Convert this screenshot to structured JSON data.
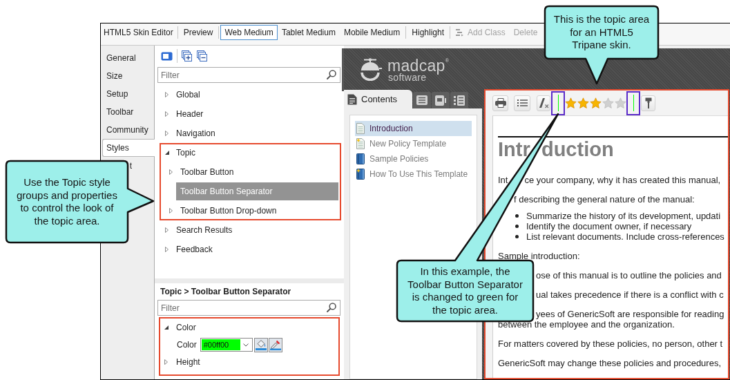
{
  "toolbar": {
    "title": "HTML5 Skin Editor",
    "groups": [
      [
        {
          "label": "Preview",
          "kind": "plain",
          "selected": false,
          "disabled": false
        }
      ],
      [
        {
          "label": "Web Medium",
          "kind": "plain",
          "selected": true,
          "disabled": false
        },
        {
          "label": "Tablet Medium",
          "kind": "plain",
          "selected": false,
          "disabled": false
        },
        {
          "label": "Mobile Medium",
          "kind": "plain",
          "selected": false,
          "disabled": false
        }
      ],
      [
        {
          "label": "Highlight",
          "kind": "plain",
          "selected": false,
          "disabled": false
        }
      ],
      [
        {
          "label": "Add Class",
          "kind": "with-icon",
          "selected": false,
          "disabled": true
        },
        {
          "label": "Delete",
          "kind": "plain",
          "selected": false,
          "disabled": true
        }
      ]
    ]
  },
  "side_tabs": [
    {
      "label": "General",
      "selected": false,
      "covered": false
    },
    {
      "label": "Size",
      "selected": false,
      "covered": false
    },
    {
      "label": "Setup",
      "selected": false,
      "covered": false
    },
    {
      "label": "Toolbar",
      "selected": false,
      "covered": false
    },
    {
      "label": "Community",
      "selected": false,
      "covered": false
    },
    {
      "label": "Styles",
      "selected": true,
      "covered": false
    },
    {
      "label": "t",
      "selected": false,
      "covered": true
    }
  ],
  "styles": {
    "filter": {
      "placeholder": "Filter"
    },
    "tree": [
      {
        "label": "Global",
        "kind": "group",
        "expanded": false,
        "selected": false,
        "highlighted": false
      },
      {
        "label": "Header",
        "kind": "group",
        "expanded": false,
        "selected": false,
        "highlighted": false
      },
      {
        "label": "Navigation",
        "kind": "group",
        "expanded": false,
        "selected": false,
        "highlighted": false
      },
      {
        "label": "Topic",
        "kind": "group",
        "expanded": true,
        "selected": false,
        "highlighted": true,
        "children": [
          {
            "label": "Toolbar Button",
            "kind": "group",
            "expanded": false,
            "selected": false,
            "highlighted": false
          },
          {
            "label": "Toolbar Button Separator",
            "kind": "leaf",
            "selected": true,
            "highlighted": false
          },
          {
            "label": "Toolbar Button Drop-down",
            "kind": "group",
            "expanded": false,
            "selected": false,
            "highlighted": false
          }
        ]
      },
      {
        "label": "Search Results",
        "kind": "group",
        "expanded": false,
        "selected": false,
        "highlighted": false
      },
      {
        "label": "Feedback",
        "kind": "group",
        "expanded": false,
        "selected": false,
        "highlighted": false
      }
    ],
    "path": "Topic > Toolbar Button Separator",
    "property_filter": {
      "placeholder": "Filter"
    },
    "properties": {
      "highlighted": true,
      "groups": [
        {
          "label": "Color",
          "expanded": true,
          "fields": [
            {
              "label": "Color",
              "value": "#00ff00"
            }
          ]
        },
        {
          "label": "Height",
          "expanded": false
        }
      ]
    }
  },
  "preview": {
    "logo": {
      "name": "madcap",
      "mark": "®",
      "tagline": "software"
    },
    "tabs": [
      {
        "label": "Contents",
        "selected": true
      },
      {
        "selected": false
      },
      {
        "selected": false
      },
      {
        "selected": false
      }
    ],
    "toc": [
      {
        "label": "Introduction",
        "kind": "page",
        "new": false,
        "selected": true
      },
      {
        "label": "New Policy Template",
        "kind": "page",
        "new": true,
        "selected": false
      },
      {
        "label": "Sample Policies",
        "kind": "book",
        "new": false,
        "selected": false
      },
      {
        "label": "How To Use This Template",
        "kind": "book",
        "new": true,
        "selected": false
      }
    ],
    "topic": {
      "highlighted": true,
      "toolbar": {
        "separators": [
          {
            "highlighted": true
          },
          {
            "highlighted": true
          }
        ],
        "rating": {
          "stars": 3
        }
      },
      "heading": [
        "Intr",
        "duction"
      ],
      "blocks": [
        {
          "kind": "paragraph",
          "lines": [
            {
              "covered": false,
              "segments": [
                "Int",
                "ce your company, why it has created this manual,"
              ]
            }
          ]
        },
        {
          "kind": "paragraph",
          "lines": [
            {
              "covered": true,
              "segments": [
                "f describing the general nature of the manual:"
              ]
            }
          ]
        },
        {
          "kind": "list",
          "items": [
            "Summarize the history of its development, updati",
            "Identify the document owner, if necessary",
            "List relevant documents. Include cross-references"
          ]
        },
        {
          "kind": "paragraph",
          "lines": [
            {
              "covered": false,
              "segments": [
                "Sample introduction:"
              ]
            }
          ]
        },
        {
          "kind": "paragraph",
          "lines": [
            {
              "covered": true,
              "segments": [
                "ose of this manual is to outline the policies and"
              ]
            }
          ]
        },
        {
          "kind": "paragraph",
          "lines": [
            {
              "covered": true,
              "segments": [
                "ual takes precedence if there is a conflict with c"
              ]
            }
          ]
        },
        {
          "kind": "paragraph",
          "lines": [
            {
              "covered": true,
              "segments": [
                "yees of GenericSoft are responsible for reading"
              ]
            },
            {
              "covered": false,
              "segments": [
                "between the employee and the organization."
              ]
            }
          ]
        },
        {
          "kind": "paragraph",
          "lines": [
            {
              "covered": false,
              "segments": [
                "For matters covered by these policies, no person, other t"
              ]
            }
          ]
        },
        {
          "kind": "paragraph",
          "lines": [
            {
              "covered": false,
              "segments": [
                "GenericSoft may change these policies and procedures,"
              ]
            }
          ]
        }
      ]
    }
  },
  "callouts": [
    {
      "text": "This is the topic area for an HTML5 Tripane skin."
    },
    {
      "text": "Use the Topic style groups and properties to control the look of the topic area."
    },
    {
      "text": "In this example, the Toolbar Button Separator is changed to green for the topic area."
    }
  ]
}
